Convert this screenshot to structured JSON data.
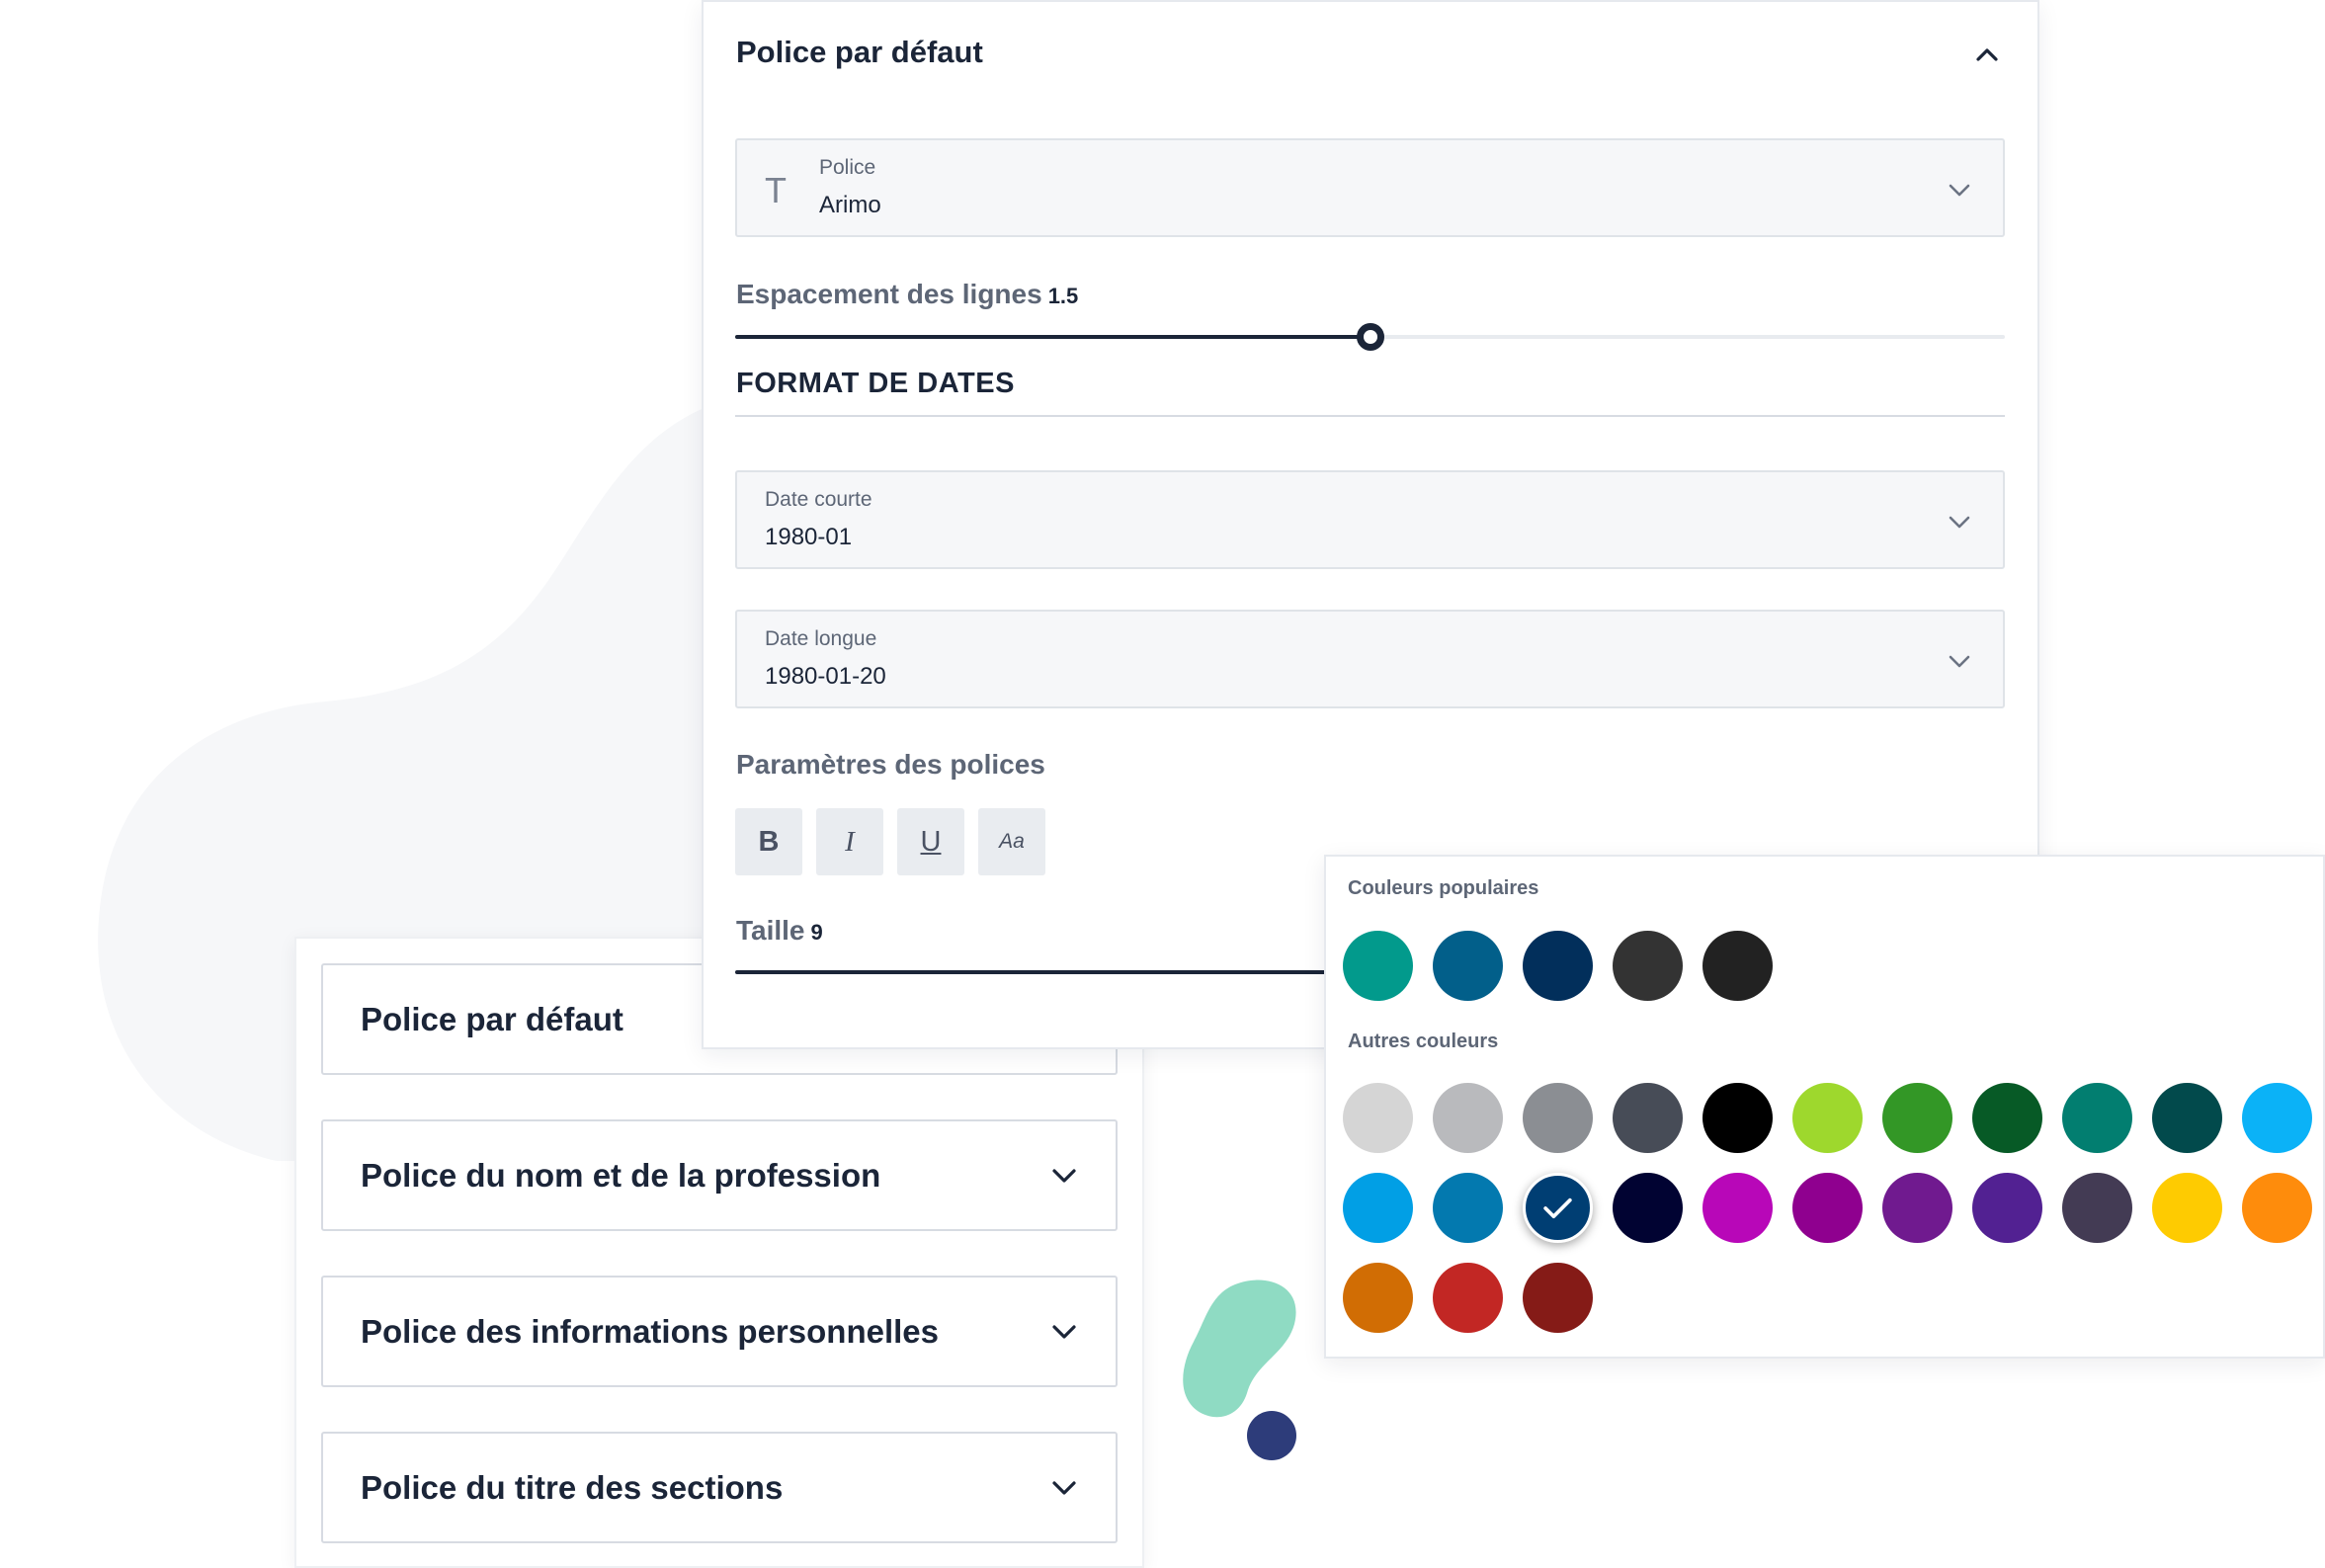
{
  "main_panel": {
    "title": "Police par défaut",
    "font_field": {
      "label": "Police",
      "value": "Arimo",
      "icon": "T"
    },
    "line_spacing": {
      "label": "Espacement des lignes",
      "value": "1.5",
      "fraction": 0.5
    },
    "date_section": {
      "heading": "FORMAT DE DATES"
    },
    "short_date": {
      "label": "Date courte",
      "value": "1980-01"
    },
    "long_date": {
      "label": "Date longue",
      "value": "1980-01-20"
    },
    "font_settings": {
      "heading": "Paramètres des polices",
      "bold": "B",
      "italic": "I",
      "underline": "U",
      "case": "Aa"
    },
    "size": {
      "label": "Taille",
      "value": "9"
    }
  },
  "accordion": {
    "items": [
      {
        "label": "Police par défaut"
      },
      {
        "label": "Police du nom et de la profession"
      },
      {
        "label": "Police des informations personnelles"
      },
      {
        "label": "Police du titre des sections"
      }
    ]
  },
  "color_picker": {
    "popular_label": "Couleurs populaires",
    "other_label": "Autres couleurs",
    "popular": [
      "#029a8c",
      "#025f8a",
      "#022f5b",
      "#333333",
      "#222222"
    ],
    "other": [
      "#d5d5d5",
      "#b9babd",
      "#8b8e93",
      "#474c57",
      "#000000",
      "#9ed82d",
      "#339726",
      "#075a26",
      "#027e70",
      "#024a4c",
      "#0bb2f7",
      "#019fe5",
      "#0379af",
      "#003e73",
      "#010332",
      "#b807b8",
      "#8f008f",
      "#701a8f",
      "#522192",
      "#433b54",
      "#fecb01",
      "#fe8c0c",
      "#d16d04",
      "#c22724",
      "#851b17"
    ],
    "selected_other_index": 13
  },
  "colors": {
    "primary": "#1b2538",
    "blob_gray": "#f6f7f9",
    "blob_mint": "#8fdbc3",
    "dot_navy": "#2d3c7a"
  }
}
